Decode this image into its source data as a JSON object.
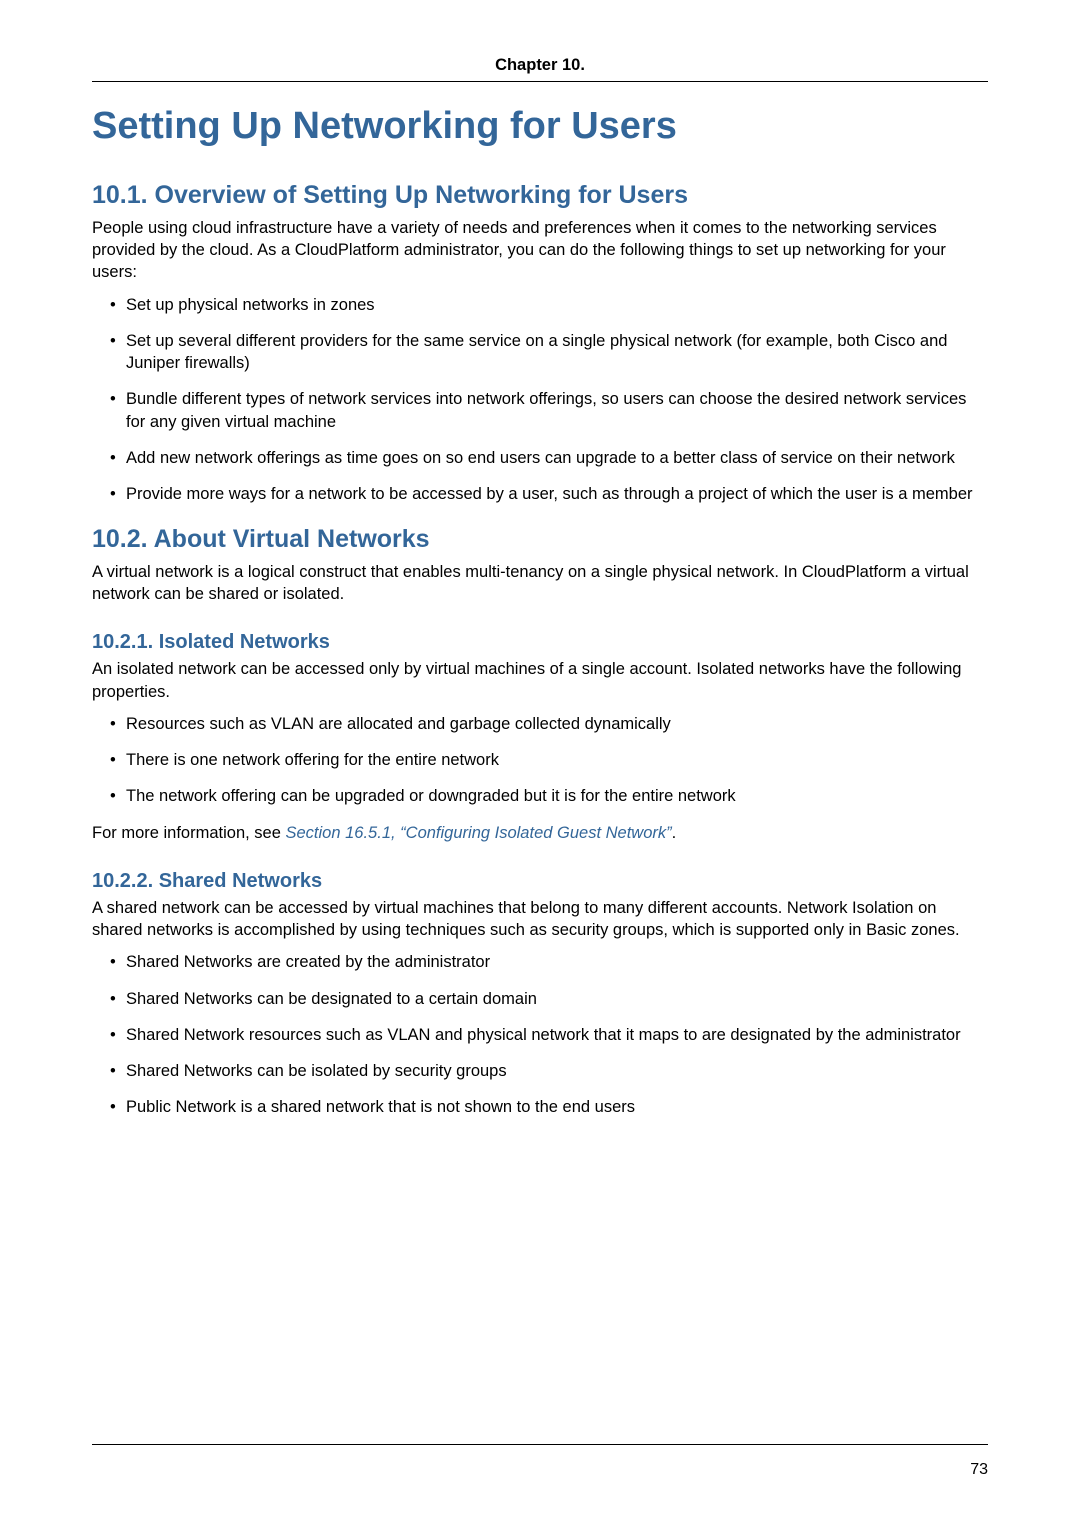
{
  "header": {
    "chapter_label": "Chapter 10."
  },
  "chapter_title": "Setting Up Networking for Users",
  "sections": {
    "s1": {
      "heading": "10.1. Overview of Setting Up Networking for Users",
      "intro": "People using cloud infrastructure have a variety of needs and preferences when it comes to the networking services provided by the cloud. As a CloudPlatform administrator, you can do the following things to set up networking for your users:",
      "bullets": [
        "Set up physical networks in zones",
        "Set up several different providers for the same service on a single physical network (for example, both Cisco and Juniper firewalls)",
        "Bundle different types of network services into network offerings, so users can choose the desired network services for any given virtual machine",
        "Add new network offerings as time goes on so end users can upgrade to a better class of service on their network",
        "Provide more ways for a network to be accessed by a user, such as through a project of which the user is a member"
      ]
    },
    "s2": {
      "heading": "10.2. About Virtual Networks",
      "intro": "A virtual network is a logical construct that enables multi-tenancy on a single physical network. In CloudPlatform a virtual network can be shared or isolated.",
      "sub1": {
        "heading": "10.2.1. Isolated Networks",
        "intro": "An isolated network can be accessed only by virtual machines of a single account. Isolated networks have the following properties.",
        "bullets": [
          "Resources such as VLAN are allocated and garbage collected dynamically",
          "There is one network offering for the entire network",
          "The network offering can be upgraded or downgraded but it is for the entire network"
        ],
        "more_info_prefix": "For more information, see ",
        "more_info_link": "Section 16.5.1, “Configuring Isolated Guest Network”",
        "more_info_suffix": "."
      },
      "sub2": {
        "heading": "10.2.2. Shared Networks",
        "intro": "A shared network can be accessed by virtual machines that belong to many different accounts. Network Isolation on shared networks is accomplished by using techniques such as security groups, which is supported only in Basic zones.",
        "bullets": [
          "Shared Networks are created by the administrator",
          "Shared Networks can be designated to a certain domain",
          "Shared Network resources such as VLAN and physical network that it maps to are designated by the administrator",
          "Shared Networks can be isolated by security groups",
          "Public Network is a shared network that is not shown to the end users"
        ]
      }
    }
  },
  "footer": {
    "page_number": "73"
  }
}
